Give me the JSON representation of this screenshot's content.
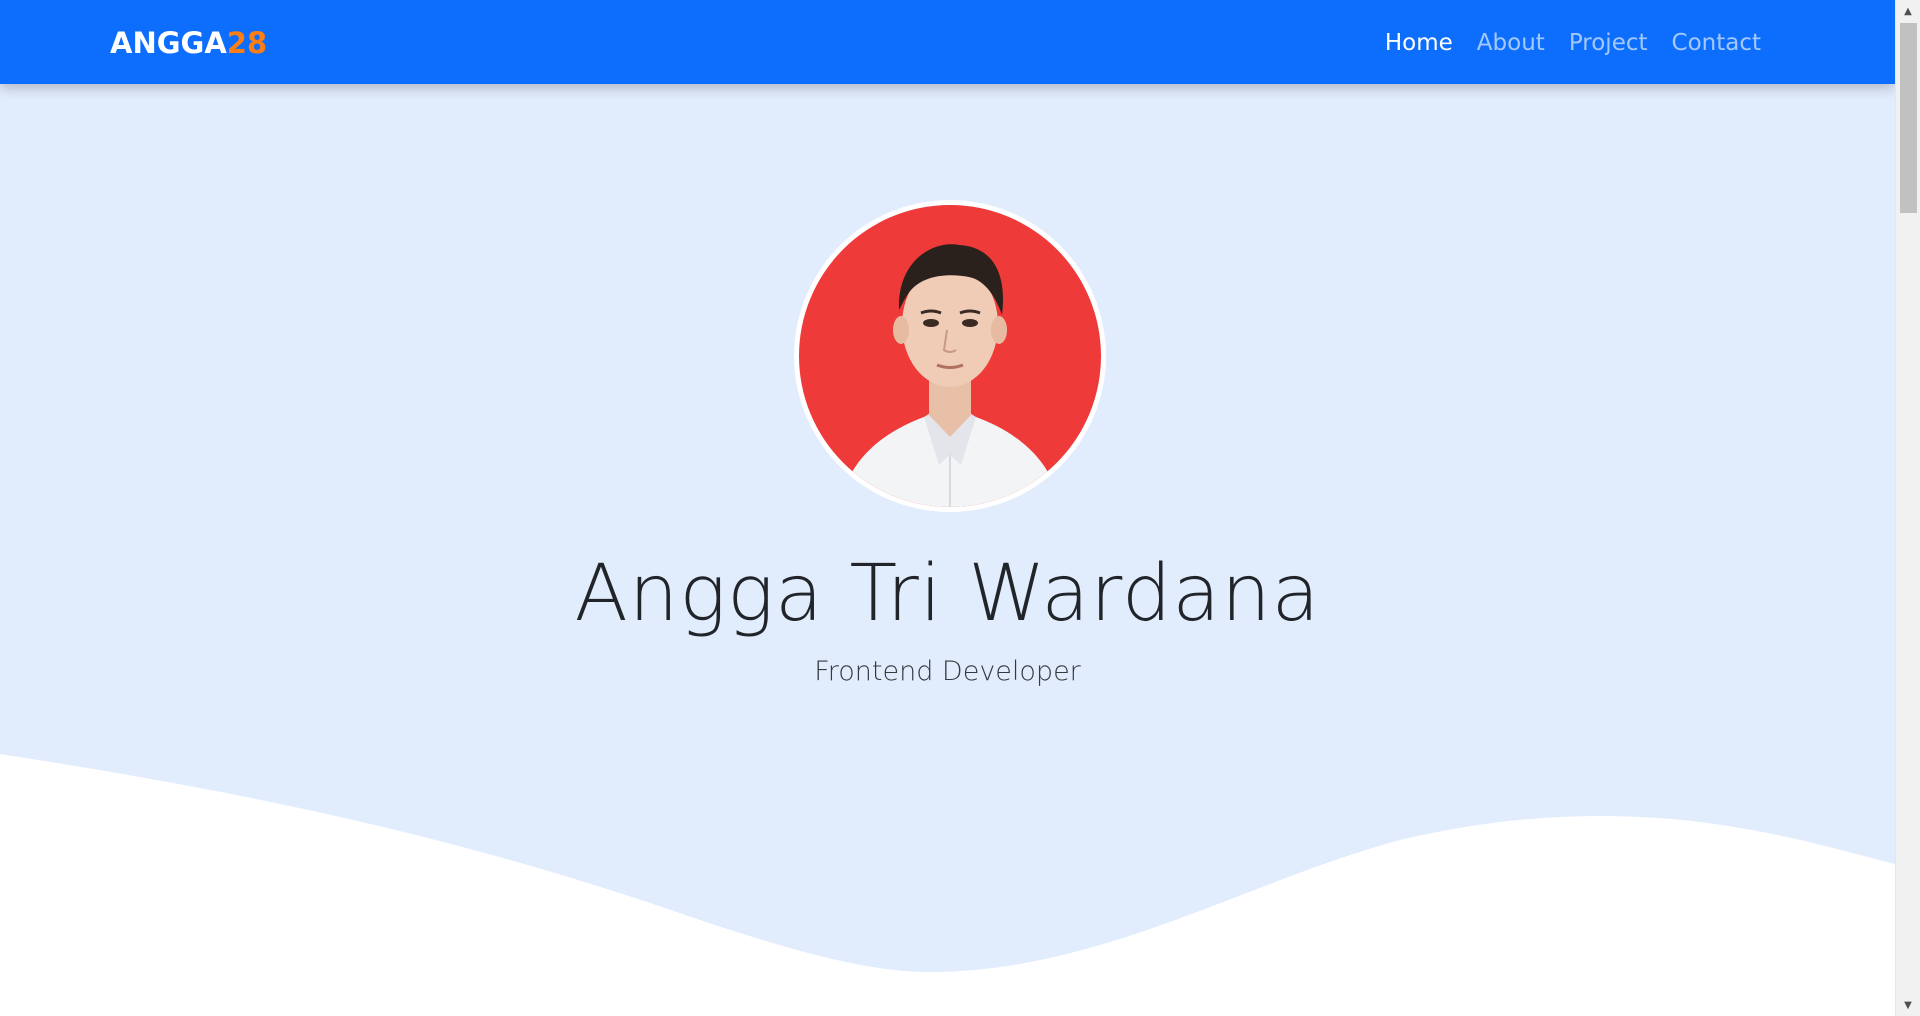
{
  "navbar": {
    "brand_main": "ANGGA",
    "brand_accent": "28",
    "links": [
      {
        "label": "Home",
        "active": true
      },
      {
        "label": "About",
        "active": false
      },
      {
        "label": "Project",
        "active": false
      },
      {
        "label": "Contact",
        "active": false
      }
    ]
  },
  "hero": {
    "name": "Angga Tri Wardana",
    "role": "Frontend Developer",
    "avatar_icon": "profile-photo"
  },
  "colors": {
    "navbar_bg": "#0d6efd",
    "brand_accent": "#fd7e14",
    "hero_bg": "#e1ecfd",
    "wave": "#ffffff",
    "avatar_bg": "#ef3a3a"
  },
  "scrollbar": {
    "up_icon": "arrow-up-icon",
    "down_icon": "arrow-down-icon"
  }
}
